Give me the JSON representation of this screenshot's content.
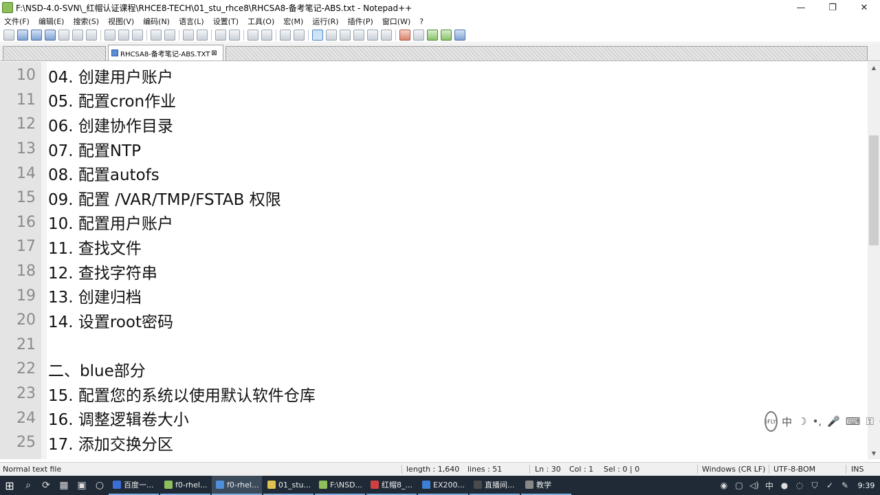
{
  "window": {
    "title": "F:\\NSD-4.0-SVN\\_红帽认证课程\\RHCE8-TECH\\01_stu_rhce8\\RHCSA8-备考笔记-ABS.txt - Notepad++",
    "minimize": "—",
    "restore": "❐",
    "close": "✕"
  },
  "menu": [
    "文件(F)",
    "编辑(E)",
    "搜索(S)",
    "视图(V)",
    "编码(N)",
    "语言(L)",
    "设置(T)",
    "工具(O)",
    "宏(M)",
    "运行(R)",
    "插件(P)",
    "窗口(W)",
    "?"
  ],
  "tabs": {
    "inactive_label": "",
    "active_label": "RHCSA8-备考笔记-ABS.TXT",
    "close_glyph": "⊠"
  },
  "editor": {
    "lines": [
      {
        "n": "10",
        "text": "04. 创建用户账户"
      },
      {
        "n": "11",
        "text": "05. 配置cron作业"
      },
      {
        "n": "12",
        "text": "06. 创建协作目录"
      },
      {
        "n": "13",
        "text": "07. 配置NTP"
      },
      {
        "n": "14",
        "text": "08. 配置autofs"
      },
      {
        "n": "15",
        "text": "09. 配置 /VAR/TMP/FSTAB 权限"
      },
      {
        "n": "16",
        "text": "10. 配置用户账户"
      },
      {
        "n": "17",
        "text": "11. 查找文件"
      },
      {
        "n": "18",
        "text": "12. 查找字符串"
      },
      {
        "n": "19",
        "text": "13. 创建归档"
      },
      {
        "n": "20",
        "text": "14. 设置root密码"
      },
      {
        "n": "21",
        "text": ""
      },
      {
        "n": "22",
        "text": "二、blue部分"
      },
      {
        "n": "23",
        "text": "15. 配置您的系统以使用默认软件仓库"
      },
      {
        "n": "24",
        "text": "16. 调整逻辑卷大小"
      },
      {
        "n": "25",
        "text": "17. 添加交换分区"
      }
    ]
  },
  "ime": {
    "logo": "iFLY",
    "buttons": [
      "中",
      "☽",
      "•,",
      "🎤",
      "⌨",
      "⚿",
      "✣"
    ]
  },
  "status": {
    "file_type": "Normal text file",
    "length": "length : 1,640",
    "lines": "lines : 51",
    "ln": "Ln : 30",
    "col": "Col : 1",
    "sel": "Sel : 0 | 0",
    "eol": "Windows (CR LF)",
    "encoding": "UTF-8-BOM",
    "mode": "INS"
  },
  "taskbar": {
    "apps": [
      {
        "label": "百度一...",
        "color": "#3b6fd6"
      },
      {
        "label": "f0-rhel...",
        "color": "#8fbf5a"
      },
      {
        "label": "f0-rhel...",
        "color": "#4f8fd9"
      },
      {
        "label": "01_stu...",
        "color": "#e0c050"
      },
      {
        "label": "F:\\NSD...",
        "color": "#8fbf5a"
      },
      {
        "label": "红帽8_...",
        "color": "#d04040"
      },
      {
        "label": "EX200...",
        "color": "#3b7fd6"
      },
      {
        "label": "直播间...",
        "color": "#4a4a4a"
      },
      {
        "label": "教学",
        "color": "#888888"
      }
    ],
    "clock": "9:39"
  }
}
